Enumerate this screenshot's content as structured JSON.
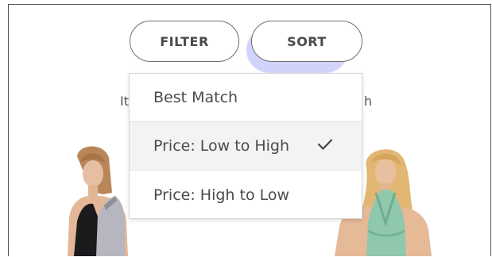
{
  "toolbar": {
    "filter_label": "FILTER",
    "sort_label": "SORT"
  },
  "background": {
    "left_fragment": "It",
    "right_fragment": "h"
  },
  "sort_menu": {
    "options": [
      {
        "label": "Best Match",
        "selected": false
      },
      {
        "label": "Price: Low to High",
        "selected": true
      },
      {
        "label": "Price: High to Low",
        "selected": false
      }
    ]
  },
  "colors": {
    "pill_border": "#6e6e6e",
    "sort_highlight": "#d1d3fb",
    "selected_row": "#f2f3f2",
    "text": "#4b4b4b"
  },
  "icons": {
    "selected_marker": "checkmark-icon"
  }
}
